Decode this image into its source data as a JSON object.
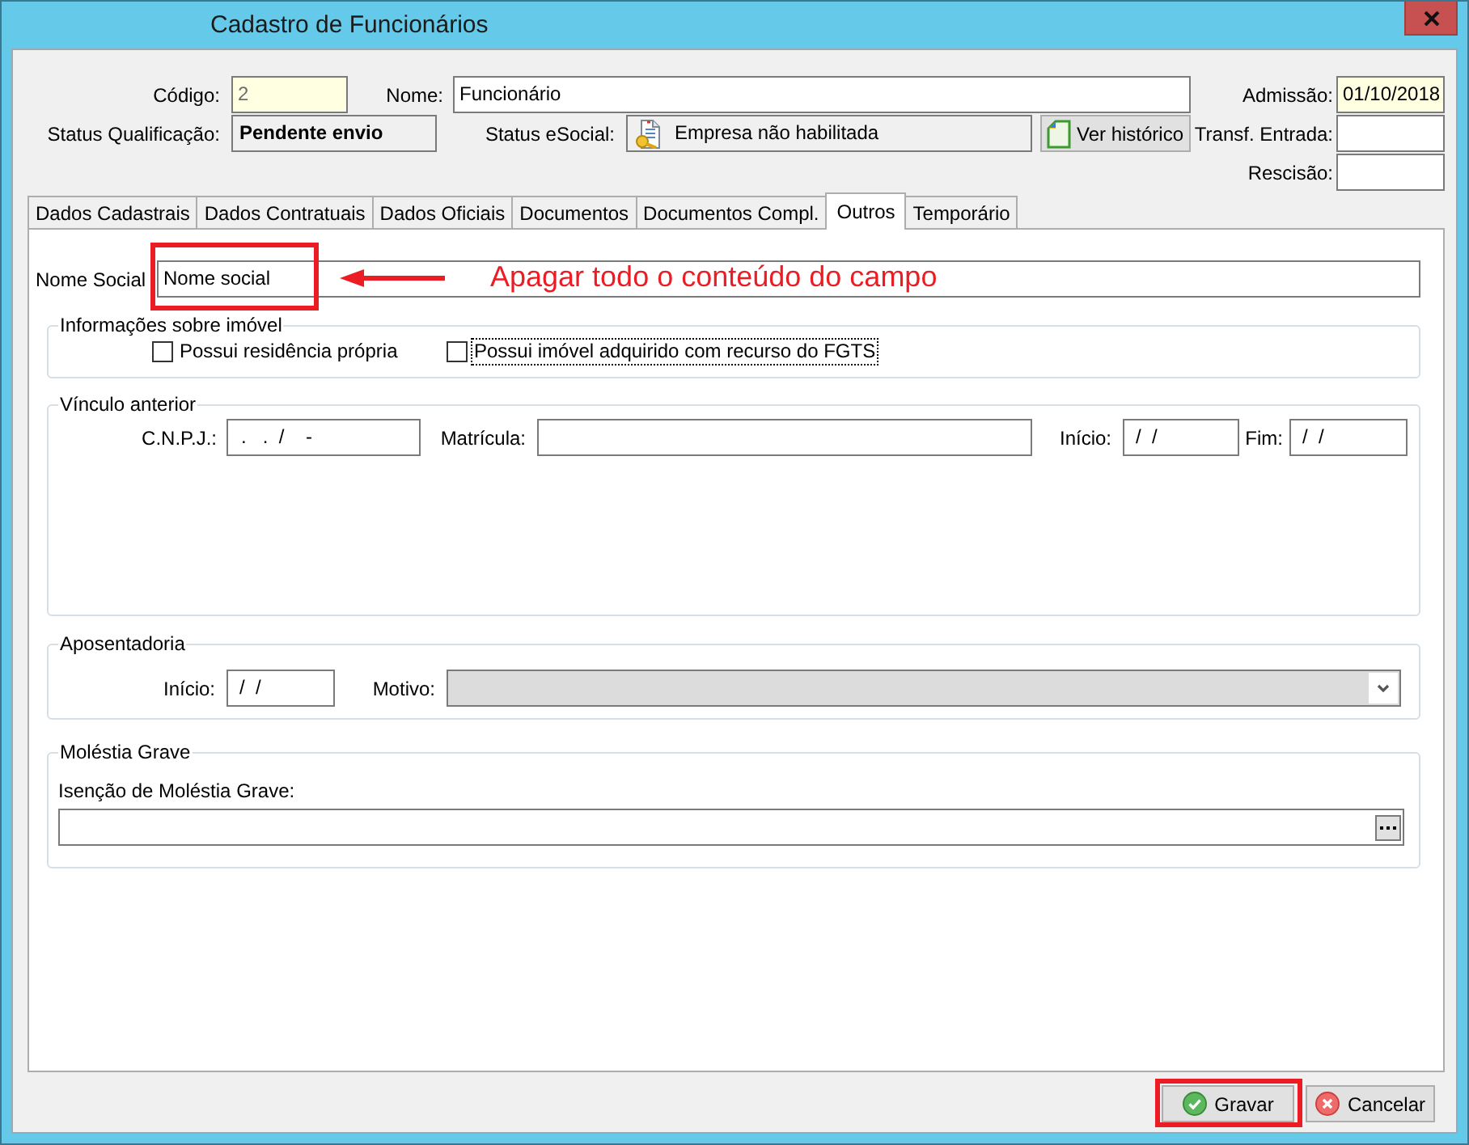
{
  "window": {
    "title": "Cadastro de Funcionários"
  },
  "header": {
    "codigo": {
      "label": "Código:",
      "value": "2",
      "required": true,
      "disabled": true
    },
    "nome": {
      "label": "Nome:",
      "value": "Funcionário",
      "required": false,
      "disabled": false
    },
    "status_qualificacao": {
      "label": "Status Qualificação:",
      "value": "Pendente envio"
    },
    "status_esocial": {
      "label": "Status eSocial:",
      "value": "Empresa não habilitada"
    },
    "history_button": {
      "label": "Ver histórico"
    },
    "dates": [
      {
        "label": "Admissão:",
        "value": "01/10/2018",
        "required": true
      },
      {
        "label": "Transf. Entrada:",
        "required": false
      },
      {
        "label": "Rescisão:",
        "required": false
      }
    ]
  },
  "tabs": [
    {
      "label": "Dados Cadastrais",
      "selected": false
    },
    {
      "label": "Dados Contratuais",
      "selected": false
    },
    {
      "label": "Dados Oficiais",
      "selected": false
    },
    {
      "label": "Documentos",
      "selected": false
    },
    {
      "label": "Documentos Compl.",
      "selected": false
    },
    {
      "label": "Outros",
      "selected": true
    },
    {
      "label": "Temporário",
      "selected": false
    }
  ],
  "nome_social": {
    "label": "Nome Social",
    "value": "Nome social",
    "highlighted": true
  },
  "annotation": {
    "text": "Apagar todo o conteúdo do campo"
  },
  "imovel": {
    "title": "Informações sobre imóvel",
    "options": [
      {
        "label": "Possui residência própria",
        "checked": false,
        "focused": false
      },
      {
        "label": "Possui imóvel adquirido com recurso do FGTS",
        "checked": false,
        "focused": true
      }
    ]
  },
  "vinculo_anterior": {
    "title": "Vínculo anterior",
    "cnpj": {
      "label": "C.N.P.J.:",
      "value": ".   .  /    -"
    },
    "matricula": {
      "label": "Matrícula:"
    },
    "inicio": {
      "label": "Início:",
      "value": "/  /"
    },
    "fim": {
      "label": "Fim:",
      "value": "/  /"
    }
  },
  "aposentadoria": {
    "title": "Aposentadoria",
    "inicio": {
      "label": "Início:",
      "value": "/  /"
    },
    "motivo": {
      "label": "Motivo:",
      "disabled": true
    }
  },
  "molestia_grave": {
    "title": "Moléstia Grave",
    "isencao": {
      "label": "Isenção de Moléstia Grave:"
    }
  },
  "buttons": [
    {
      "label": "Gravar",
      "kind": "save",
      "highlighted": true
    },
    {
      "label": "Cancelar",
      "kind": "cancel",
      "highlighted": false
    }
  ]
}
